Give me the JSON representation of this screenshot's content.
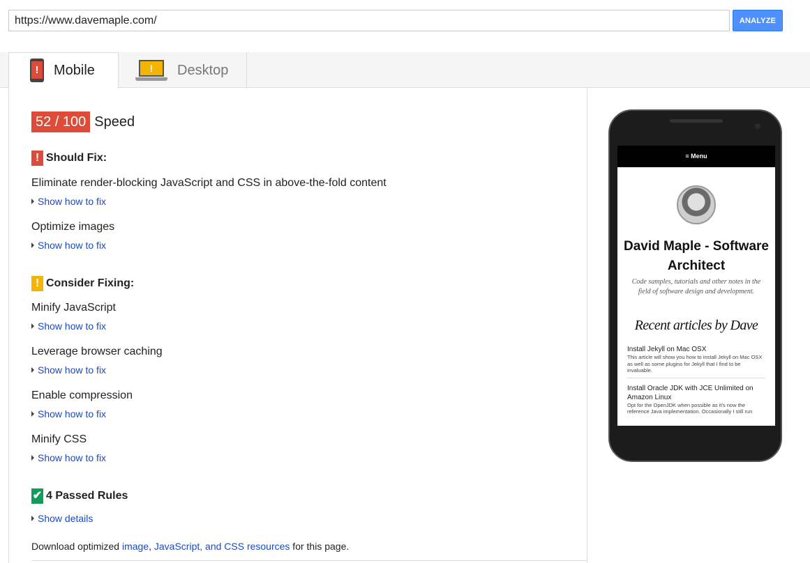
{
  "url_bar": {
    "value": "https://www.davemaple.com/",
    "analyze_label": "ANALYZE"
  },
  "tabs": [
    {
      "label": "Mobile",
      "icon": "mobile-phone-icon",
      "active": true
    },
    {
      "label": "Desktop",
      "icon": "laptop-icon",
      "active": false
    }
  ],
  "score": {
    "value": "52 / 100",
    "label": "Speed",
    "color": "#dd4b39"
  },
  "should_fix": {
    "heading": "Should Fix:",
    "flag": "!",
    "rules": [
      {
        "title": "Eliminate render-blocking JavaScript and CSS in above-the-fold content",
        "link": "Show how to fix"
      },
      {
        "title": "Optimize images",
        "link": "Show how to fix"
      }
    ]
  },
  "consider_fixing": {
    "heading": "Consider Fixing:",
    "flag": "!",
    "rules": [
      {
        "title": "Minify JavaScript",
        "link": "Show how to fix"
      },
      {
        "title": "Leverage browser caching",
        "link": "Show how to fix"
      },
      {
        "title": "Enable compression",
        "link": "Show how to fix"
      },
      {
        "title": "Minify CSS",
        "link": "Show how to fix"
      }
    ]
  },
  "passed": {
    "heading": "4 Passed Rules",
    "flag": "✔",
    "link": "Show details"
  },
  "download": {
    "prefix": "Download optimized ",
    "link_image": "image",
    "sep": ", ",
    "link_js_css": "JavaScript, and CSS resources",
    "suffix": " for this page."
  },
  "preview": {
    "menu": "≡ Menu",
    "site_title": "David Maple - Software Architect",
    "site_desc": "Code samples, tutorials and other notes in the field of software design and development.",
    "recent_heading": "Recent articles by Dave",
    "articles": [
      {
        "title": "Install Jekyll on Mac OSX",
        "excerpt": "This article will show you how to install Jekyll on Mac OSX as well as some plugins for Jekyll that I find to be invaluable."
      },
      {
        "title": "Install Oracle JDK with JCE Unlimited on Amazon Linux",
        "excerpt": "Opt for the OpenJDK when possible as it's now the reference Java implementation. Occasionally I still run"
      }
    ]
  }
}
